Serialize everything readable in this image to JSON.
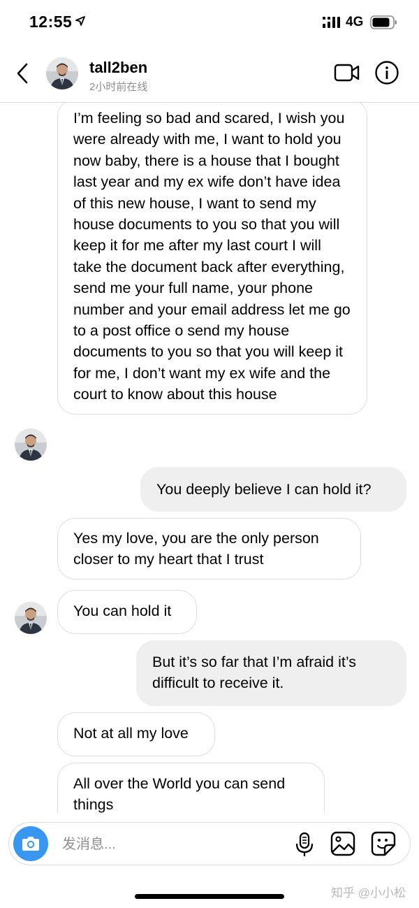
{
  "status_bar": {
    "time": "12:55",
    "network": "4G"
  },
  "header": {
    "username": "tall2ben",
    "active_status": "2小时前在线",
    "icons": [
      "back-icon",
      "video-call-icon",
      "info-icon"
    ]
  },
  "messages": [
    {
      "direction": "incoming",
      "text": "I’m feeling so bad and scared, I wish you were already with me, I want to hold you now baby, there is a house that I bought last year and my ex wife don’t have idea of this new house, I want to send my house documents to you so that you will keep it for me after my last court I will take the document back after everything, send me your full name, your phone number and your email address let me go to a post office o send my house documents to you so that you will keep it for me, I don’t want my ex wife and the court to know about this house"
    },
    {
      "direction": "outgoing",
      "text": "You deeply believe I can hold it?"
    },
    {
      "direction": "incoming",
      "text": "Yes my love, you are the only person closer to my heart that I trust"
    },
    {
      "direction": "incoming",
      "text": "You can hold it"
    },
    {
      "direction": "outgoing",
      "text": "But it’s so far that I’m afraid it’s difficult to receive it."
    },
    {
      "direction": "incoming",
      "text": "Not at all my love"
    },
    {
      "direction": "incoming",
      "text": "All over the World you can send things"
    }
  ],
  "composer": {
    "placeholder": "发消息...",
    "icons": [
      "camera-icon",
      "microphone-icon",
      "gallery-icon",
      "sticker-icon"
    ]
  },
  "watermark": "知乎 @小小松",
  "colors": {
    "accent": "#3897f0",
    "outgoing_bubble": "#efefef",
    "border": "#dbdbdb",
    "secondary_text": "#8e8e8e"
  }
}
